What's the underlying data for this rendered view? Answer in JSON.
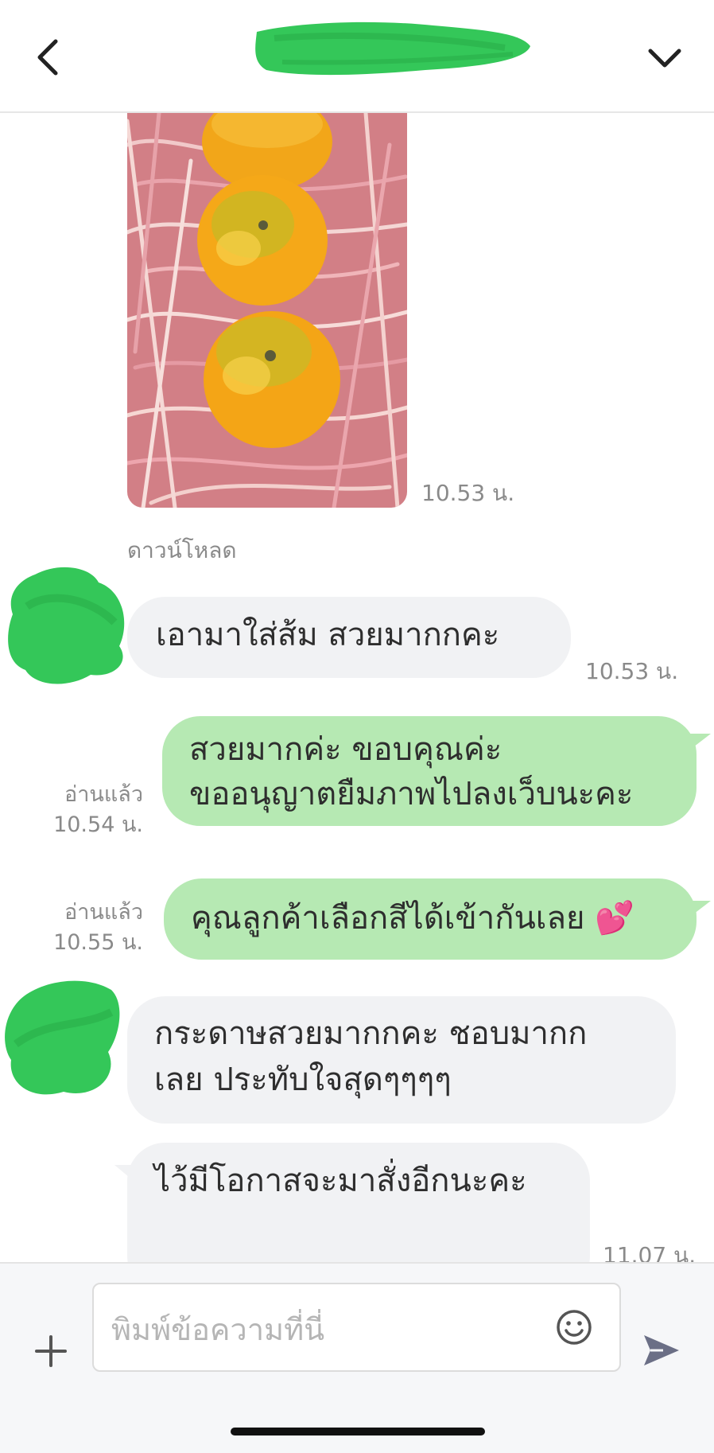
{
  "header": {
    "back_icon": "chevron-left-icon",
    "menu_icon": "chevron-down-icon"
  },
  "messages": [
    {
      "type": "image",
      "subject": "oranges-in-shredded-paper",
      "time": "10.53 น.",
      "download_label": "ดาวน์โหลด"
    },
    {
      "type": "received",
      "text": "เอามาใส่ส้ม  สวยมากกคะ",
      "time": "10.53 น."
    },
    {
      "type": "sent",
      "lines": [
        "สวยมากค่ะ ขอบคุณค่ะ",
        "ขออนุญาตยืมภาพไปลงเว็บนะคะ"
      ],
      "read": "อ่านแล้ว",
      "time": "10.54 น."
    },
    {
      "type": "sent",
      "text": "คุณลูกค้าเลือกสีได้เข้ากันเลย ",
      "emoji": "💕",
      "read": "อ่านแล้ว",
      "time": "10.55 น."
    },
    {
      "type": "received",
      "lines": [
        "กระดาษสวยมากกคะ  ชอบมากก",
        "เลย  ประทับใจสุดๆๆๆๆ"
      ]
    },
    {
      "type": "received",
      "text": "ไว้มีโอกาสจะมาสั่งอีกนะคะ",
      "time": "11.07 น."
    }
  ],
  "input": {
    "placeholder": "พิมพ์ข้อความที่นี่",
    "icons": [
      "plus-icon",
      "smiley-icon",
      "send-icon"
    ]
  },
  "colors": {
    "sent_bubble": "#b6e9b3",
    "received_bubble": "#f1f2f4",
    "redaction_green": "#34c759"
  }
}
